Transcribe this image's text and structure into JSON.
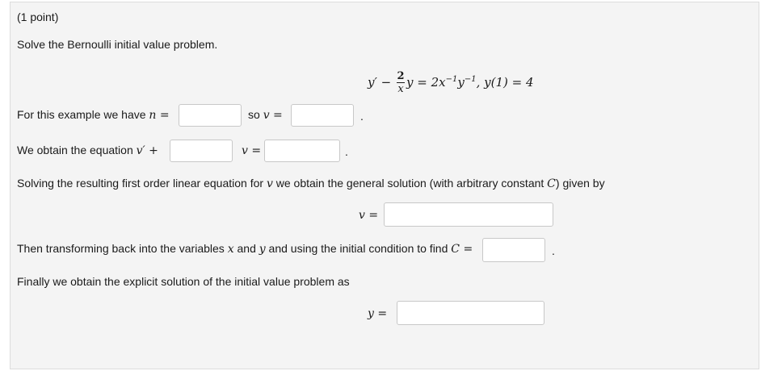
{
  "problem": {
    "points": "(1 point)",
    "instruction": "Solve the Bernoulli initial value problem.",
    "equation": {
      "lhs_start": "y′ −",
      "frac_num": "2",
      "frac_den": "x",
      "lhs_end": "y = 2x",
      "exp1": "−1",
      "mid": "y",
      "exp2": "−1",
      "ic": ",  y(1) = 4"
    }
  },
  "step_n": {
    "prefix": "For this example we have ",
    "var": "n",
    "eq": " =",
    "so_text": "so ",
    "v_var": "v",
    "v_eq": " =",
    "end": "."
  },
  "step_eq": {
    "prefix": "We obtain the equation ",
    "lhs": "v′",
    "plus": " +",
    "v_var": "v",
    "v_eq": " =",
    "end": "."
  },
  "step_general": {
    "text_a": "Solving the resulting first order linear equation for ",
    "v_var": "v",
    "text_b": " we obtain the general solution (with arbitrary constant ",
    "c_var": "C",
    "text_c": ") given by",
    "lhs_var": "v",
    "lhs_eq": " ="
  },
  "step_c": {
    "text_a": "Then transforming back into the variables ",
    "x_var": "x",
    "text_b": " and ",
    "y_var": "y",
    "text_c": " and using the initial condition to find ",
    "c_var": "C",
    "c_eq": " =",
    "end": "."
  },
  "step_final": {
    "text": "Finally we obtain the explicit solution of the initial value problem as",
    "lhs_var": "y",
    "lhs_eq": " ="
  },
  "inputs": {
    "n_value": "",
    "v_value": "",
    "v_coeff_value": "",
    "rhs_value": "",
    "general_value": "",
    "c_value": "",
    "y_value": ""
  }
}
